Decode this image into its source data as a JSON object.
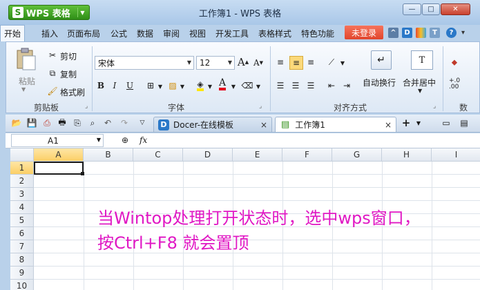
{
  "title_bar": {
    "app_button": "WPS 表格",
    "app_button_logo": "S",
    "window_title": "工作簿1 - WPS 表格",
    "icons": [
      "minimize-icon",
      "maximize-icon",
      "close-icon"
    ]
  },
  "menu": {
    "tabs": [
      "开始",
      "插入",
      "页面布局",
      "公式",
      "数据",
      "审阅",
      "视图",
      "开发工具",
      "表格样式",
      "特色功能"
    ],
    "active": "开始",
    "login": "未登录",
    "accent": "#e34a30"
  },
  "ribbon": {
    "clipboard": {
      "paste": "粘贴",
      "cut": "剪切",
      "copy": "复制",
      "format_painter": "格式刷",
      "group_label": "剪贴板"
    },
    "font": {
      "font_name": "宋体",
      "font_size": "12",
      "bold": "B",
      "italic": "I",
      "underline": "U",
      "grow": "A",
      "shrink": "A",
      "group_label": "字体"
    },
    "alignment": {
      "wrap_text": "自动换行",
      "merge_center": "合并居中",
      "group_label": "对齐方式"
    },
    "number": {
      "decimal_inc": "+.0\n.00",
      "group_label_partial": "数"
    }
  },
  "tabs": {
    "docer": "Docer-在线模板",
    "sheet": "工作簿1",
    "close": "×",
    "add": "+"
  },
  "formula_bar": {
    "name_box": "A1",
    "fx": "fx"
  },
  "grid": {
    "columns": [
      "A",
      "B",
      "C",
      "D",
      "E",
      "F",
      "G",
      "H",
      "I"
    ],
    "rows": [
      "1",
      "2",
      "3",
      "4",
      "5",
      "6",
      "7",
      "8",
      "9",
      "10"
    ],
    "selected_cell": "A1"
  },
  "overlay_text": {
    "line1": "当Wintop处理打开状态时，选中wps窗口，",
    "line2": "按Ctrl+F8 就会置顶",
    "color": "#e018c4"
  }
}
